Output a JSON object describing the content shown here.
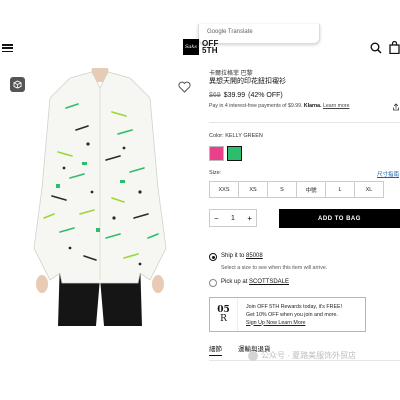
{
  "translate_popup": {
    "label": "Google Translate"
  },
  "header": {
    "logo_box": "Saks",
    "logo_line1": "OFF",
    "logo_line2": "5TH"
  },
  "product": {
    "brand": "卡爾拉格菲 巴黎",
    "title": "異想天開的印花鈕扣襯衫",
    "price_original": "$69",
    "price_sale": "$39.99",
    "price_off": "(42% OFF)",
    "installment_text": "Pay in 4 interest-free payments of $9.99.",
    "installment_brand": "Klarna.",
    "installment_link": "Learn more"
  },
  "color": {
    "label": "Color: KELLY GREEN",
    "swatches": [
      {
        "name": "pink",
        "hex": "#e8408a"
      },
      {
        "name": "kelly-green",
        "hex": "#2ebd6c",
        "selected": true
      }
    ]
  },
  "size": {
    "label": "Size:",
    "guide_link": "尺寸指南",
    "options": [
      "XXS",
      "XS",
      "S",
      "中號",
      "L",
      "XL"
    ]
  },
  "quantity": {
    "value": "1",
    "minus": "−",
    "plus": "+"
  },
  "add_to_bag": "ADD TO BAG",
  "fulfillment": {
    "ship_prefix": "Ship it to ",
    "ship_zip": "85008",
    "ship_note": "Select a size to see when this item will arrive.",
    "pickup_prefix": "Pick up at ",
    "pickup_store": "SCOTTSDALE"
  },
  "rewards": {
    "logo_top": "05",
    "logo_bottom": "R",
    "line1": "Join OFF 5TH Rewards today, it's FREE!",
    "line2": "Get 10% OFF when you join and more.",
    "link": "Sign Up Now Learn More"
  },
  "tabs": [
    "細節",
    "運輸與退貨"
  ],
  "watermark": "公众号 · 夏路美服饰外贸店"
}
